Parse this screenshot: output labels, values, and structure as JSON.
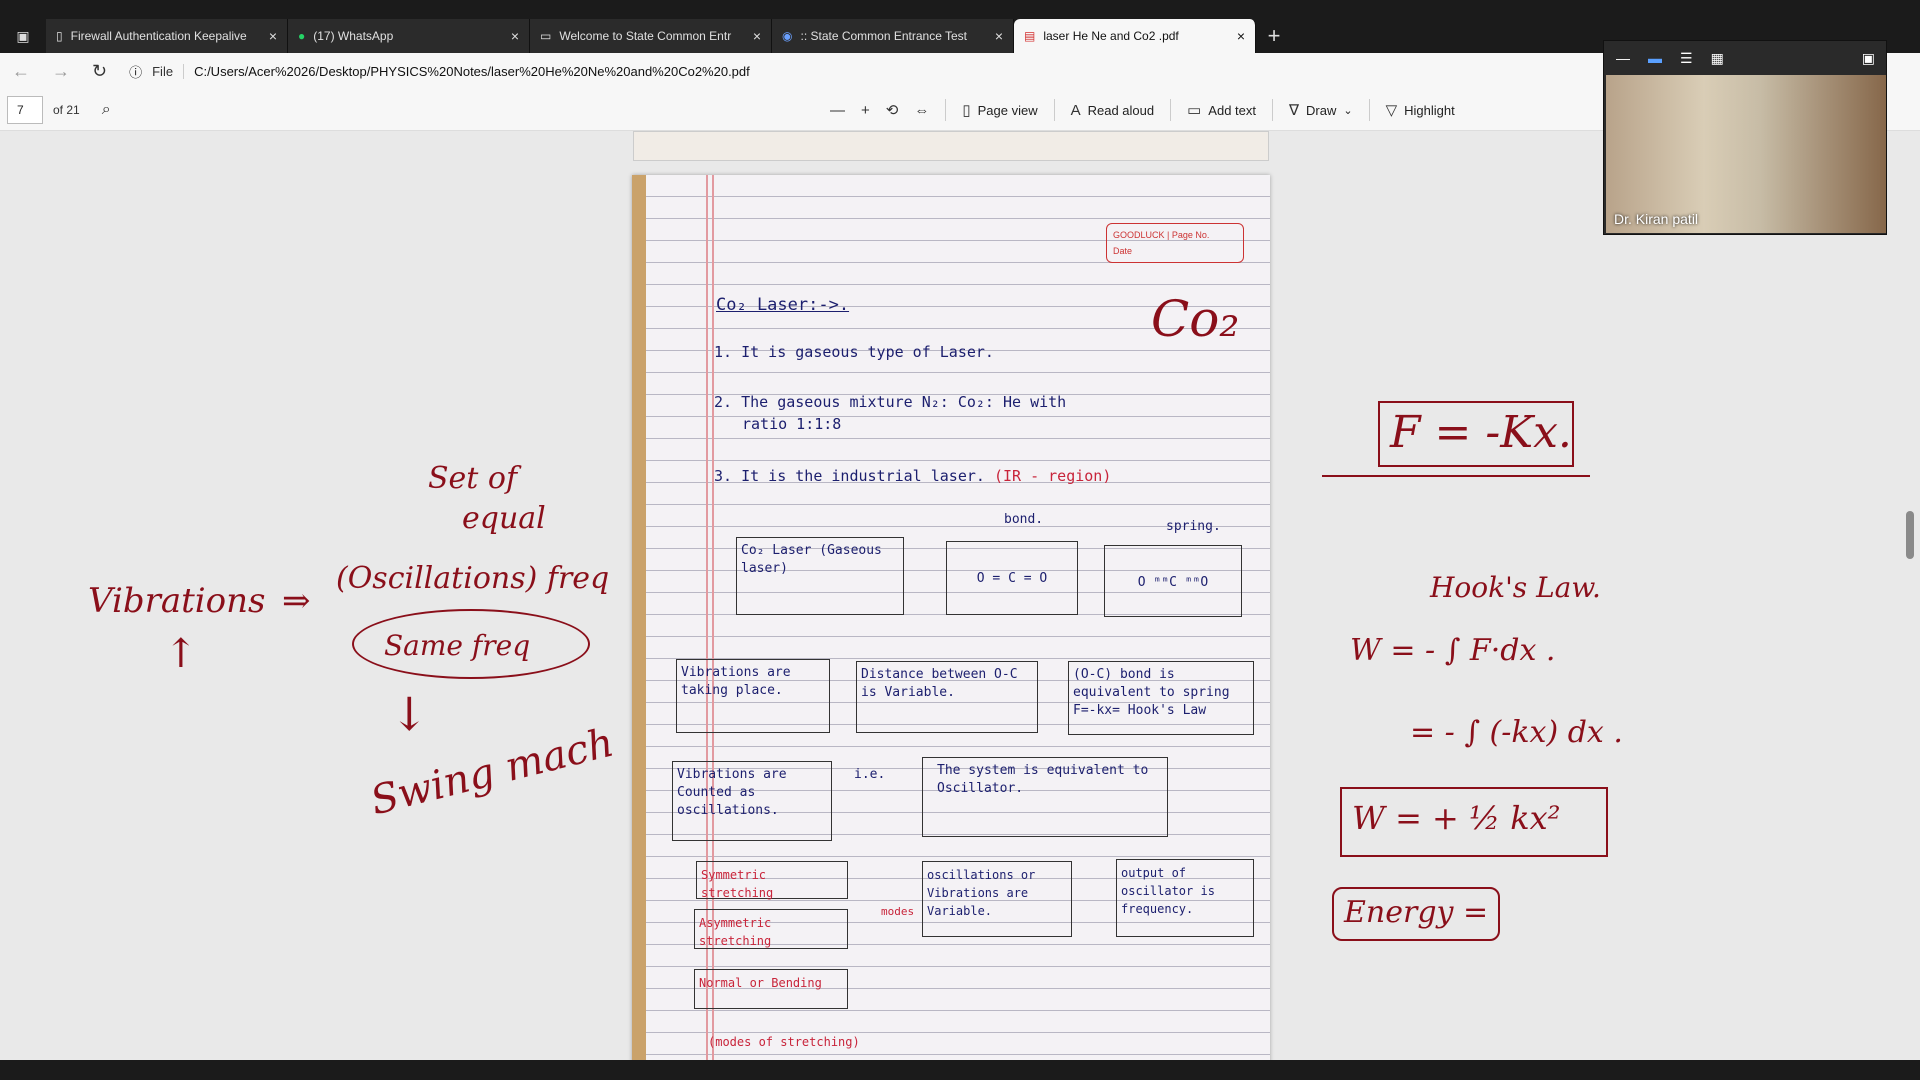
{
  "tabs": [
    {
      "label": "Firewall Authentication Keepalive",
      "icon": "document-icon",
      "active": false
    },
    {
      "label": "(17) WhatsApp",
      "icon": "whatsapp-icon",
      "active": false
    },
    {
      "label": "Welcome to State Common Entr",
      "icon": "site-icon",
      "active": false
    },
    {
      "label": ":: State Common Entrance Test",
      "icon": "site-icon",
      "active": false
    },
    {
      "label": "laser He Ne and Co2 .pdf",
      "icon": "pdf-icon",
      "active": true
    }
  ],
  "address": {
    "file_label": "File",
    "url": "C:/Users/Acer%2026/Desktop/PHYSICS%20Notes/laser%20He%20Ne%20and%20Co2%20.pdf"
  },
  "pdf_toolbar": {
    "page_number": "7",
    "page_total": "of 21",
    "page_view": "Page view",
    "read_aloud": "Read aloud",
    "add_text": "Add text",
    "draw": "Draw",
    "highlight": "Highlight"
  },
  "notebook": {
    "stamp_brand": "GOODLUCK",
    "stamp_page": "Page No.",
    "stamp_date": "Date",
    "heading": "Co₂ Laser:->.",
    "line1": "1. It is  gaseous  type  of Laser.",
    "line2a": "2. The gaseous  mixture  N₂: Co₂: He  with",
    "line2b": "ratio   1:1:8",
    "line3": "3. It is   the industrial  laser.",
    "line3_red": "(IR - region)",
    "bond_label": "bond.",
    "spring_label": "spring.",
    "box_co2": "Co₂ Laser (Gaseous laser)",
    "box_ocо": "O = C = O",
    "box_spring": "O ᵐᵐC ᵐᵐO",
    "box_vibrations": "Vibrations are taking place.",
    "box_distance": "Distance between O-C is Variable.",
    "box_bond": "(O-C) bond is equivalent to spring F=-kx= Hook's Law",
    "box_counted": "Vibrations are Counted as oscillations.",
    "ie": "i.e.",
    "box_system": "The system is equivalent to Oscillator.",
    "box_sym": "Symmetric stretching",
    "box_asym": "Asymmetric stretching",
    "box_normal": "Normal or Bending",
    "modes": "modes",
    "box_osc": "oscillations or Vibrations are Variable.",
    "box_output": "output of oscillator is frequency.",
    "modes_of": "(modes of stretching)",
    "co2_big": "Co₂"
  },
  "ink_left": {
    "set_of": "Set of",
    "equal": "equal",
    "vibrations": "Vibrations",
    "oscillations": "(Oscillations) freq",
    "same_freq": "Same freq",
    "swing": "Swing mach"
  },
  "ink_right": {
    "formula": "F = -Kx.",
    "hooks": "Hook's Law.",
    "work1": "W = - ∫ F·dx .",
    "work2": "= - ∫ (-kx) dx .",
    "work3": "W  =  + ½ kx²",
    "energy": "Energy ="
  },
  "video": {
    "name": "Dr. Kiran patil"
  }
}
